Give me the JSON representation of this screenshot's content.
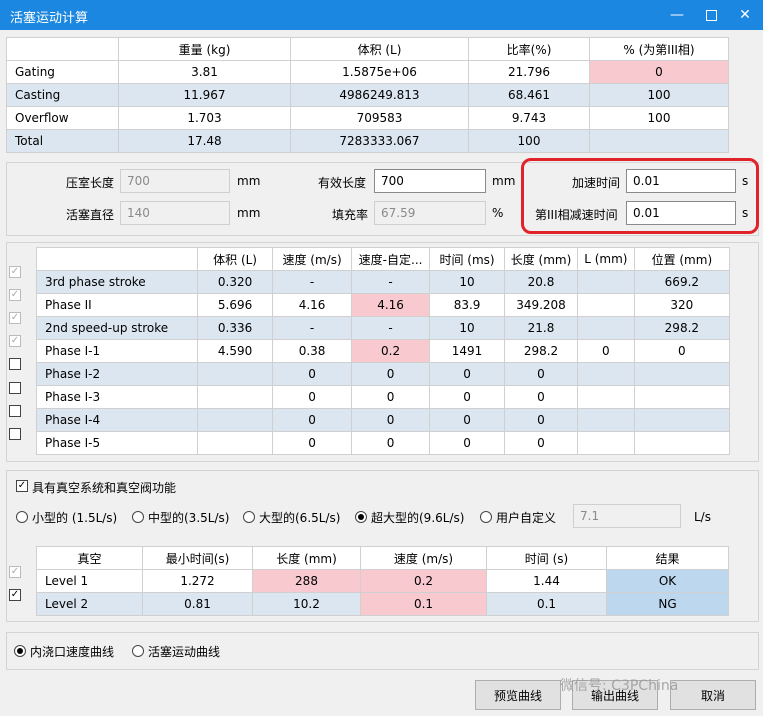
{
  "window": {
    "title": "活塞运动计算"
  },
  "summary": {
    "headers": [
      "",
      "重量 (kg)",
      "体积 (L)",
      "比率(%)",
      "% (为第III相)"
    ],
    "rows": [
      [
        "Gating",
        "3.81",
        "1.5875e+06",
        "21.796",
        "0"
      ],
      [
        "Casting",
        "11.967",
        "4986249.813",
        "68.461",
        "100"
      ],
      [
        "Overflow",
        "1.703",
        "709583",
        "9.743",
        "100"
      ],
      [
        "Total",
        "17.48",
        "7283333.067",
        "100",
        ""
      ]
    ]
  },
  "params": {
    "chamber_length_label": "压室长度",
    "chamber_length": "700",
    "unit_mm1": "mm",
    "effective_length_label": "有效长度",
    "effective_length": "700",
    "unit_mm2": "mm",
    "accel_time_label": "加速时间",
    "accel_time": "0.01",
    "unit_s1": "s",
    "plunger_dia_label": "活塞直径",
    "plunger_dia": "140",
    "unit_mm3": "mm",
    "fill_rate_label": "填充率",
    "fill_rate": "67.59",
    "unit_pct": "%",
    "decel_time_label": "第III相减速时间",
    "decel_time": "0.01",
    "unit_s2": "s"
  },
  "phases": {
    "headers": [
      "",
      "体积 (L)",
      "速度 (m/s)",
      "速度-自定...",
      "时间 (ms)",
      "长度 (mm)",
      "L (mm)",
      "位置 (mm)"
    ],
    "rows": [
      [
        "3rd phase stroke",
        "0.320",
        "-",
        "-",
        "10",
        "20.8",
        "",
        "669.2"
      ],
      [
        "Phase II",
        "5.696",
        "4.16",
        "4.16",
        "83.9",
        "349.208",
        "",
        "320"
      ],
      [
        "2nd speed-up stroke",
        "0.336",
        "-",
        "-",
        "10",
        "21.8",
        "",
        "298.2"
      ],
      [
        "Phase I-1",
        "4.590",
        "0.38",
        "0.2",
        "1491",
        "298.2",
        "0",
        "0"
      ],
      [
        "Phase I-2",
        "",
        "0",
        "0",
        "0",
        "0",
        "",
        ""
      ],
      [
        "Phase I-3",
        "",
        "0",
        "0",
        "0",
        "0",
        "",
        ""
      ],
      [
        "Phase I-4",
        "",
        "0",
        "0",
        "0",
        "0",
        "",
        ""
      ],
      [
        "Phase I-5",
        "",
        "0",
        "0",
        "0",
        "0",
        "",
        ""
      ]
    ],
    "checked": [
      true,
      true,
      true,
      true,
      false,
      false,
      false,
      false
    ]
  },
  "vacuum": {
    "system_label": "具有真空系统和真空阀功能",
    "system_checked": true,
    "options": [
      "小型的 (1.5L/s)",
      "中型的(3.5L/s)",
      "大型的(6.5L/s)",
      "超大型的(9.6L/s)",
      "用户自定义"
    ],
    "selected": 3,
    "custom_value": "7.1",
    "custom_unit": "L/s",
    "headers": [
      "真空",
      "最小时间(s)",
      "长度 (mm)",
      "速度 (m/s)",
      "时间 (s)",
      "结果"
    ],
    "rows": [
      [
        "Level 1",
        "1.272",
        "288",
        "0.2",
        "1.44",
        "OK"
      ],
      [
        "Level 2",
        "0.81",
        "10.2",
        "0.1",
        "0.1",
        "NG"
      ]
    ],
    "checked": [
      true,
      true
    ]
  },
  "curves": {
    "options": [
      "内浇口速度曲线",
      "活塞运动曲线"
    ],
    "selected": 0
  },
  "buttons": {
    "preview": "预览曲线",
    "export": "输出曲线",
    "cancel": "取消"
  },
  "watermark": "微信号: C3PChina",
  "colors": {
    "titlebar": "#1c87e0",
    "pink": "#f9c9d0",
    "blue_row": "#dce6f1",
    "highlight": "#e0222a"
  }
}
